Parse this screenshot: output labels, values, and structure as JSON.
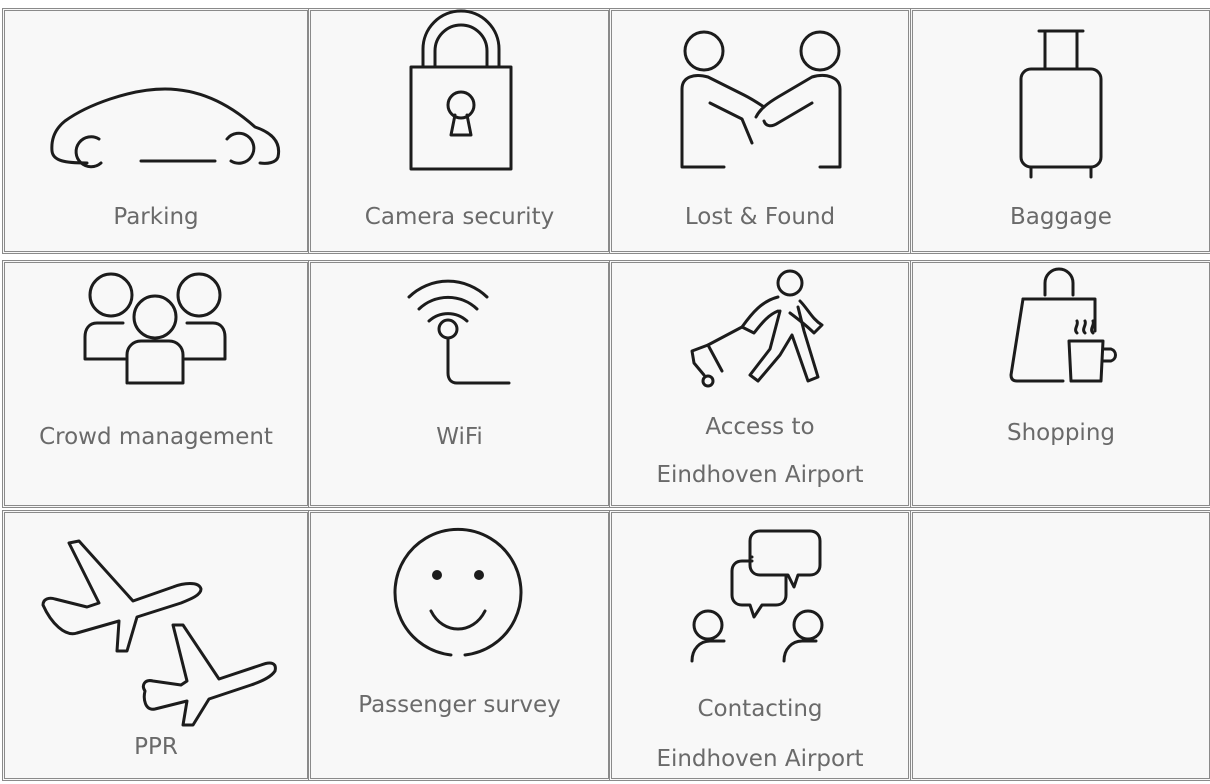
{
  "tiles": [
    {
      "label": "Parking",
      "icon": "car-icon"
    },
    {
      "label": "Camera security",
      "icon": "lock-icon"
    },
    {
      "label": "Lost & Found",
      "icon": "handshake-icon"
    },
    {
      "label": "Baggage",
      "icon": "suitcase-icon"
    },
    {
      "label": "Crowd management",
      "icon": "people-group-icon"
    },
    {
      "label": "WiFi",
      "icon": "wifi-icon"
    },
    {
      "label": "Access to",
      "label2": "Eindhoven Airport",
      "icon": "walking-traveller-icon"
    },
    {
      "label": "Shopping",
      "icon": "shopping-bag-coffee-icon"
    },
    {
      "label": "PPR",
      "icon": "airplanes-icon"
    },
    {
      "label": "Passenger survey",
      "icon": "smiley-icon"
    },
    {
      "label": "Contacting",
      "label2": "Eindhoven Airport",
      "icon": "chat-people-icon"
    }
  ]
}
